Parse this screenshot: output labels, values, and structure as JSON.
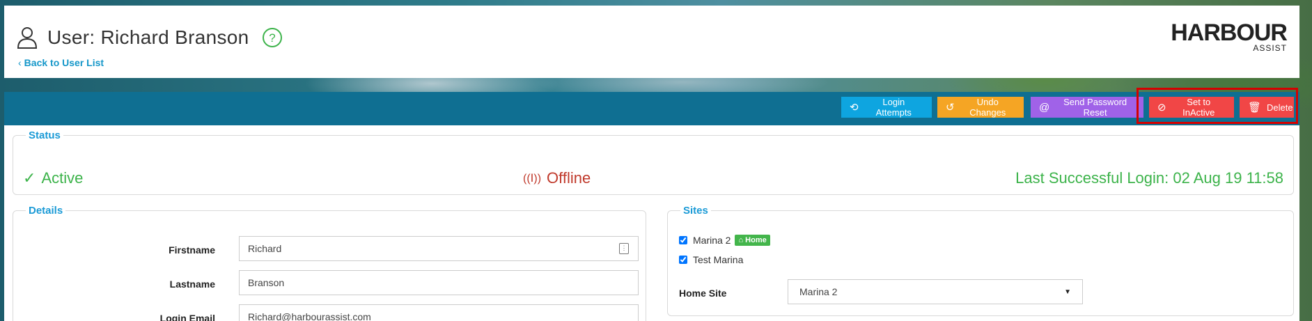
{
  "header": {
    "title": "User: Richard Branson",
    "back_link": "Back to User List",
    "logo_main": "HARBOUR",
    "logo_sub": "ASSIST"
  },
  "toolbar": {
    "login_attempts": "Login Attempts",
    "undo_changes": "Undo Changes",
    "send_password_reset": "Send Password Reset",
    "set_inactive": "Set to InActive",
    "delete": "Delete"
  },
  "status": {
    "legend": "Status",
    "active": "Active",
    "connection": "Offline",
    "last_login": "Last Successful Login: 02 Aug 19 11:58"
  },
  "details": {
    "legend": "Details",
    "firstname_label": "Firstname",
    "firstname_value": "Richard",
    "lastname_label": "Lastname",
    "lastname_value": "Branson",
    "email_label": "Login Email",
    "email_value": "Richard@harbourassist.com"
  },
  "sites": {
    "legend": "Sites",
    "items": [
      {
        "name": "Marina 2",
        "checked": true,
        "badge": "Home"
      },
      {
        "name": "Test Marina",
        "checked": true
      }
    ],
    "home_site_label": "Home Site",
    "home_site_value": "Marina 2"
  },
  "colors": {
    "toolbar": "#0f6f92",
    "login_btn": "#0ea5e0",
    "undo_btn": "#f5a524",
    "reset_btn": "#a062e8",
    "danger_btn": "#f14646",
    "success": "#3cb34a",
    "offline": "#c0392b",
    "legend": "#1a9ad6"
  }
}
